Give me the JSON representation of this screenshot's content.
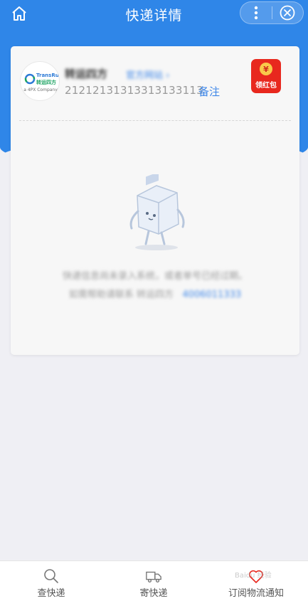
{
  "header": {
    "title": "快递详情"
  },
  "package": {
    "company_name": "转运四方",
    "official_link": "官方网站",
    "tracking_number": "21212131313313133113",
    "remark_label": "备注",
    "logo_brand": "TransRush",
    "logo_cn": "转运四方",
    "logo_sub": "a 4PX Company"
  },
  "redpacket": {
    "coin": "¥",
    "label": "领红包"
  },
  "empty": {
    "message": "快递信息尚未录入系统，或者单号已经过期。",
    "phone_prefix": "如需帮助请联系 转运四方",
    "phone": "4006011333"
  },
  "tabbar": {
    "query": "查快递",
    "send": "寄快递",
    "subscribe": "订阅物流通知"
  },
  "watermark": "Baidu 经验",
  "colors": {
    "primary": "#2f86e8",
    "link": "#3d86e8",
    "red": "#e8281e"
  }
}
